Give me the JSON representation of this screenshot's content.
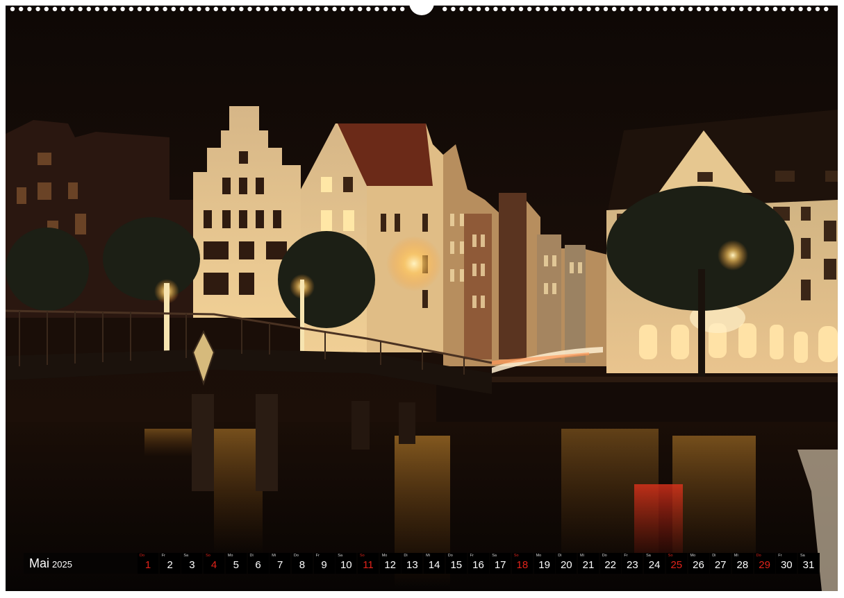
{
  "month": {
    "name": "Mai",
    "year": "2025"
  },
  "days": [
    {
      "dow": "Do",
      "num": "1",
      "red": true
    },
    {
      "dow": "Fr",
      "num": "2",
      "red": false
    },
    {
      "dow": "Sa",
      "num": "3",
      "red": false
    },
    {
      "dow": "So",
      "num": "4",
      "red": true
    },
    {
      "dow": "Mo",
      "num": "5",
      "red": false
    },
    {
      "dow": "Di",
      "num": "6",
      "red": false
    },
    {
      "dow": "Mi",
      "num": "7",
      "red": false
    },
    {
      "dow": "Do",
      "num": "8",
      "red": false
    },
    {
      "dow": "Fr",
      "num": "9",
      "red": false
    },
    {
      "dow": "Sa",
      "num": "10",
      "red": false
    },
    {
      "dow": "So",
      "num": "11",
      "red": true
    },
    {
      "dow": "Mo",
      "num": "12",
      "red": false
    },
    {
      "dow": "Di",
      "num": "13",
      "red": false
    },
    {
      "dow": "Mi",
      "num": "14",
      "red": false
    },
    {
      "dow": "Do",
      "num": "15",
      "red": false
    },
    {
      "dow": "Fr",
      "num": "16",
      "red": false
    },
    {
      "dow": "Sa",
      "num": "17",
      "red": false
    },
    {
      "dow": "So",
      "num": "18",
      "red": true
    },
    {
      "dow": "Mo",
      "num": "19",
      "red": false
    },
    {
      "dow": "Di",
      "num": "20",
      "red": false
    },
    {
      "dow": "Mi",
      "num": "21",
      "red": false
    },
    {
      "dow": "Do",
      "num": "22",
      "red": false
    },
    {
      "dow": "Fr",
      "num": "23",
      "red": false
    },
    {
      "dow": "Sa",
      "num": "24",
      "red": false
    },
    {
      "dow": "So",
      "num": "25",
      "red": true
    },
    {
      "dow": "Mo",
      "num": "26",
      "red": false
    },
    {
      "dow": "Di",
      "num": "27",
      "red": false
    },
    {
      "dow": "Mi",
      "num": "28",
      "red": false
    },
    {
      "dow": "Do",
      "num": "29",
      "red": true
    },
    {
      "dow": "Fr",
      "num": "30",
      "red": false
    },
    {
      "dow": "Sa",
      "num": "31",
      "red": false
    }
  ],
  "colors": {
    "holiday": "#e2231a",
    "day_cell": "#000000",
    "day_text": "#ffffff",
    "sky": "#120a07",
    "water": "#0d0806",
    "facade_lit": "#e8c690"
  }
}
